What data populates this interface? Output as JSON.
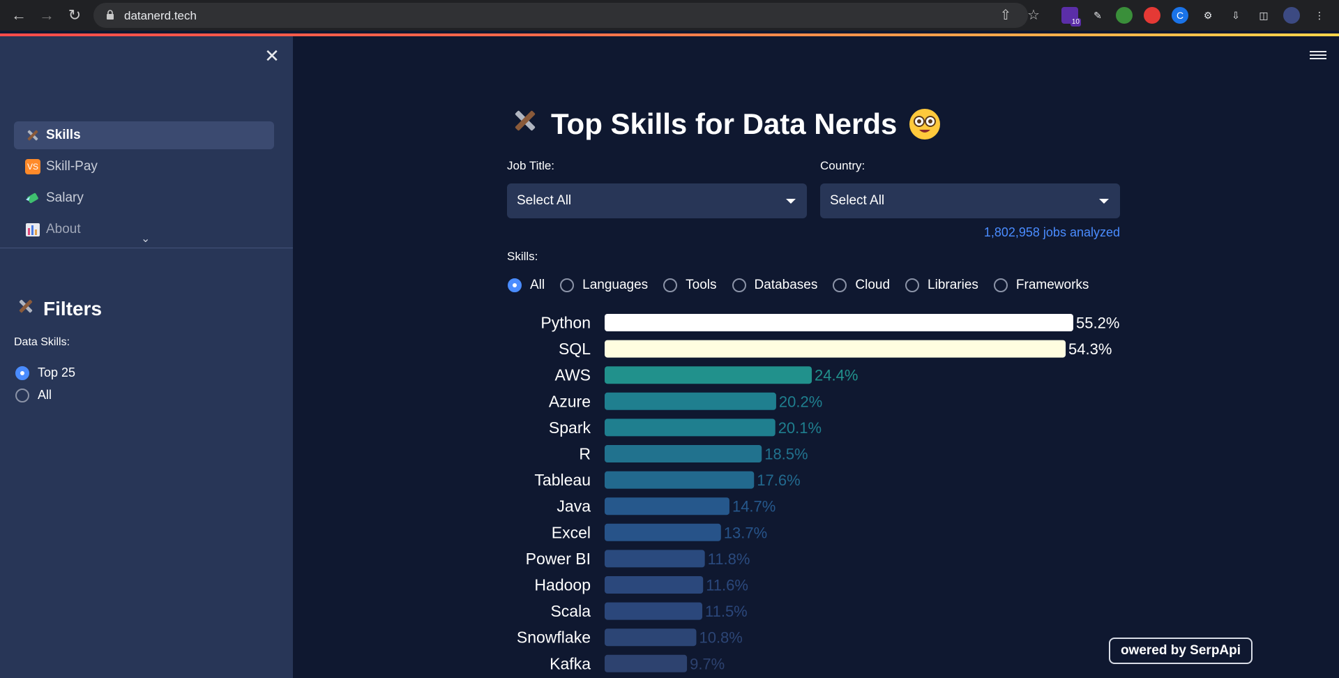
{
  "browser": {
    "url": "datanerd.tech",
    "extension_badge": "10"
  },
  "sidebar": {
    "items": [
      {
        "label": "Skills",
        "icon": "hammer-wrench-icon",
        "active": true
      },
      {
        "label": "Skill-Pay",
        "icon": "vs-badge-icon",
        "icon_text": "VS",
        "active": false
      },
      {
        "label": "Salary",
        "icon": "money-wings-icon",
        "active": false
      },
      {
        "label": "About",
        "icon": "bar-chart-icon",
        "active": false
      }
    ],
    "filters_title": "Filters",
    "data_skills_label": "Data Skills:",
    "data_skills_options": [
      {
        "label": "Top 25",
        "selected": true
      },
      {
        "label": "All",
        "selected": false
      }
    ]
  },
  "main": {
    "title": "Top Skills for Data Nerds",
    "job_title_label": "Job Title:",
    "job_title_value": "Select All",
    "country_label": "Country:",
    "country_value": "Select All",
    "jobs_analyzed": "1,802,958 jobs analyzed",
    "skills_label": "Skills:",
    "skill_categories": [
      {
        "label": "All",
        "selected": true
      },
      {
        "label": "Languages",
        "selected": false
      },
      {
        "label": "Tools",
        "selected": false
      },
      {
        "label": "Databases",
        "selected": false
      },
      {
        "label": "Cloud",
        "selected": false
      },
      {
        "label": "Libraries",
        "selected": false
      },
      {
        "label": "Frameworks",
        "selected": false
      }
    ],
    "powered_by": "owered by SerpApi"
  },
  "chart_data": {
    "type": "bar",
    "orientation": "horizontal",
    "categories": [
      "Python",
      "SQL",
      "AWS",
      "Azure",
      "Spark",
      "R",
      "Tableau",
      "Java",
      "Excel",
      "Power BI",
      "Hadoop",
      "Scala",
      "Snowflake",
      "Kafka"
    ],
    "values": [
      55.2,
      54.3,
      24.4,
      20.2,
      20.1,
      18.5,
      17.6,
      14.7,
      13.7,
      11.8,
      11.6,
      11.5,
      10.8,
      9.7
    ],
    "value_labels": [
      "55.2%",
      "54.3%",
      "24.4%",
      "20.2%",
      "20.1%",
      "18.5%",
      "17.6%",
      "14.7%",
      "13.7%",
      "11.8%",
      "11.6%",
      "11.5%",
      "10.8%",
      "9.7%"
    ],
    "colors": [
      "#ffffff",
      "#fffde0",
      "#21918c",
      "#1f7f8f",
      "#1f7f8f",
      "#21728e",
      "#22698e",
      "#26588c",
      "#275389",
      "#2a4a7e",
      "#2b487c",
      "#2b477b",
      "#2c4575",
      "#2d426f"
    ],
    "label_colors": [
      "#ffffff",
      "#ffffff",
      "#21918c",
      "#1f7f8f",
      "#1f7f8f",
      "#21728e",
      "#22698e",
      "#26588c",
      "#275389",
      "#2a4a7e",
      "#2b487c",
      "#2b477b",
      "#2c4575",
      "#2d426f"
    ],
    "xlim": [
      0,
      55.2
    ]
  }
}
